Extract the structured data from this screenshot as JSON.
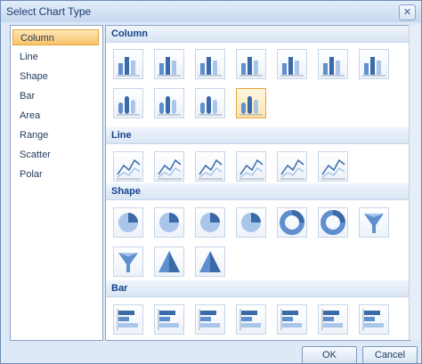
{
  "window": {
    "title": "Select Chart Type",
    "close_glyph": "✕"
  },
  "categories": [
    "Column",
    "Line",
    "Shape",
    "Bar",
    "Area",
    "Range",
    "Scatter",
    "Polar"
  ],
  "selected_category": "Column",
  "sections": [
    {
      "label": "Column",
      "tiles": [
        "column-clustered",
        "column-stacked",
        "column-stacked-100",
        "column-3d-clustered",
        "column-3d-stacked",
        "column-3d-stacked-100",
        "column-3d",
        "cylinder-clustered",
        "cylinder-stacked",
        "cylinder-stacked-100",
        "cylinder-3d"
      ],
      "selected": 10
    },
    {
      "label": "Line",
      "tiles": [
        "line",
        "line-smooth",
        "line-step",
        "line-3d",
        "line-markers",
        "line-scatter"
      ]
    },
    {
      "label": "Shape",
      "tiles": [
        "pie",
        "pie-exploded",
        "pie-3d",
        "pie-3d-exploded",
        "doughnut",
        "doughnut-exploded",
        "funnel",
        "funnel-3d",
        "pyramid",
        "pyramid-3d"
      ]
    },
    {
      "label": "Bar",
      "tiles": [
        "bar-clustered",
        "bar-stacked",
        "bar-stacked-100",
        "bar-3d-clustered",
        "bar-3d-stacked",
        "bar-3d-stacked-100",
        "bar-cylinder"
      ]
    }
  ],
  "buttons": {
    "ok": "OK",
    "cancel": "Cancel"
  },
  "colors": {
    "accent": "#f9c26a",
    "header": "#15428b"
  }
}
